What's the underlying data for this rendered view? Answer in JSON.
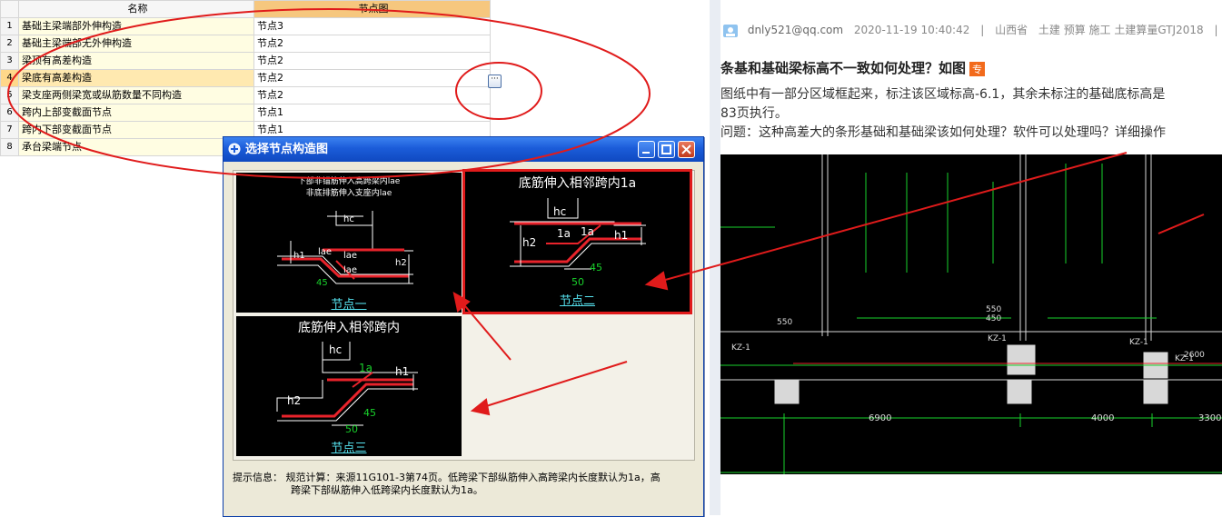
{
  "grid": {
    "headers": {
      "name": "名称",
      "node": "节点图"
    },
    "rows": [
      {
        "num": "1",
        "name": "基础主梁端部外伸构造",
        "node": "节点3"
      },
      {
        "num": "2",
        "name": "基础主梁端部无外伸构造",
        "node": "节点2"
      },
      {
        "num": "3",
        "name": "梁顶有高差构造",
        "node": "节点2"
      },
      {
        "num": "4",
        "name": "梁底有高差构造",
        "node": "节点2"
      },
      {
        "num": "5",
        "name": "梁支座两侧梁宽或纵筋数量不同构造",
        "node": "节点2"
      },
      {
        "num": "6",
        "name": "跨内上部变截面节点",
        "node": "节点1"
      },
      {
        "num": "7",
        "name": "跨内下部变截面节点",
        "node": "节点1"
      },
      {
        "num": "8",
        "name": "承台梁端节点",
        "node": ""
      }
    ],
    "ellipsis": "···"
  },
  "dialog": {
    "title": "选择节点构造图",
    "panels": [
      {
        "line1": "下部非锚筋伸入高跨梁内lae",
        "line2": "非底排筋伸入支座内lae",
        "caption": "节点一",
        "labels": {
          "hc": "hc",
          "h1": "h1",
          "h2": "h2",
          "lae_a": "lae",
          "lae_b": "lae",
          "lae_c": "lae",
          "angle": "45"
        }
      },
      {
        "title": "底筋伸入相邻跨内1a",
        "caption": "节点二",
        "labels": {
          "hc": "hc",
          "h1": "h1",
          "h2": "h2",
          "la_a": "1a",
          "la_b": "1a",
          "angle": "45",
          "dim": "50"
        }
      },
      {
        "title": "底筋伸入相邻跨内",
        "caption": "节点三",
        "labels": {
          "hc": "hc",
          "h1": "h1",
          "h2": "h2",
          "la": "1a",
          "angle": "45",
          "dim": "50"
        }
      }
    ],
    "hint_line1": "提示信息： 规范计算：来源11G101-3第74页。低跨梁下部纵筋伸入高跨梁内长度默认为1a，高",
    "hint_line2": "跨梁下部纵筋伸入低跨梁内长度默认为1a。"
  },
  "post": {
    "user": "dnly521@qq.com",
    "time": "2020-11-19 10:40:42",
    "sep": "|",
    "location": "山西省",
    "tags": "土建 预算 施工 土建算量GTJ2018",
    "title": "条基和基础梁标高不一致如何处理？如图",
    "badge": "专",
    "body_line1": "图纸中有一部分区域框起来，标注该区域标高-6.1，其余未标注的基础底标高是",
    "body_line2": "83页执行。",
    "body_line3": "问题：这种高差大的条形基础和基础梁该如何处理？软件可以处理吗？详细操作"
  },
  "cad": {
    "dims": [
      "6900",
      "4000",
      "3300"
    ],
    "labels": [
      "KZ-1",
      "KZ-1",
      "KZ-1",
      "KZ-1",
      "550",
      "550",
      "450",
      "2600"
    ]
  },
  "colors": {
    "annotation": "#e01b1b",
    "rebar": "#e8232b",
    "cad_green": "#19d22b",
    "cad_white": "#ffffff"
  }
}
